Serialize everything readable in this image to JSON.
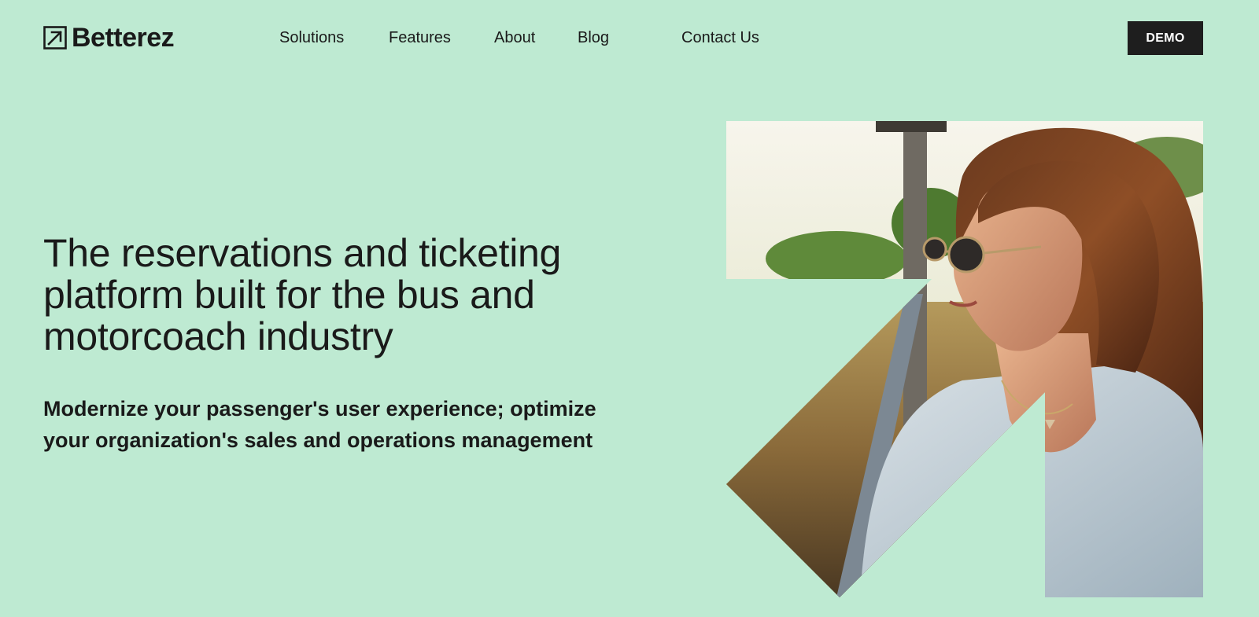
{
  "brand": {
    "name": "Betterez",
    "icon": "arrow-up-right-icon"
  },
  "nav": {
    "items": [
      {
        "label": "Solutions"
      },
      {
        "label": "Features"
      },
      {
        "label": "About"
      },
      {
        "label": "Blog"
      },
      {
        "label": "Contact Us"
      }
    ],
    "cta_label": "DEMO"
  },
  "hero": {
    "heading": "The reservations and ticketing platform built for the bus and motorcoach industry",
    "subheading": "Modernize your passenger's user experience; optimize your organization's sales and operations management"
  },
  "colors": {
    "background": "#BEEAD2",
    "text": "#1A1A1A",
    "button": "#1E1E1E",
    "button_text": "#FFFFFF"
  }
}
